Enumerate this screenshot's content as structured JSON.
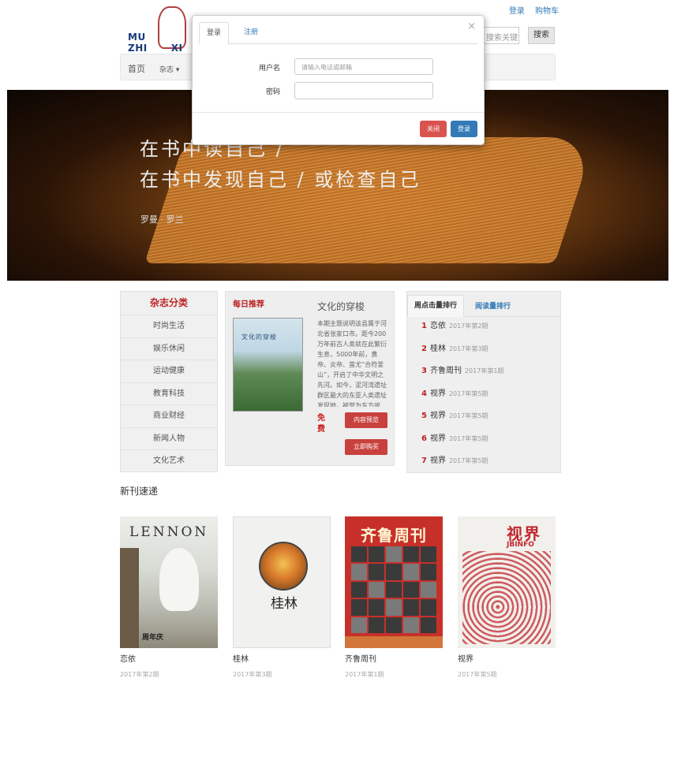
{
  "header": {
    "links": [
      "登录",
      "购物车"
    ],
    "logo_text": "MU ZHI",
    "logo_tail": "XI",
    "search_placeholder": "搜索关键词",
    "search_button": "搜索"
  },
  "nav": {
    "home": "首页",
    "magazine": "杂志 ▾"
  },
  "hero": {
    "line1": "在书中读自己 /",
    "line2": "在书中发现自己 / 或检查自己",
    "author": "罗曼 · 罗兰"
  },
  "categories": {
    "title": "杂志分类",
    "items": [
      "时尚生活",
      "娱乐休闲",
      "运动健康",
      "教育科技",
      "商业财经",
      "新闻人物",
      "文化艺术"
    ]
  },
  "daily": {
    "label": "每日推荐",
    "cover_title": "文化的穿梭",
    "name": "文化的穿梭",
    "description": "本期主题说明该县属于河北省张家口市。距今200万年前古人类就在此繁衍生息，5000年前，黄帝、炎帝、蚩尤“合符釜山”，开启了中华文明之先河。如今，泥河湾遗址群区最大的东亚人类遗址发现地，被誉为东方故乡。",
    "free": "免费",
    "preview_button": "内容预览",
    "buy_button": "立即购买"
  },
  "ranking": {
    "tab_active": "周点击量排行",
    "tab_other": "阅读量排行",
    "rows": [
      {
        "num": "1",
        "name": "恋依",
        "issue": "2017年第2期"
      },
      {
        "num": "2",
        "name": "桂林",
        "issue": "2017年第3期"
      },
      {
        "num": "3",
        "name": "齐鲁周刊",
        "issue": "2017年第1期"
      },
      {
        "num": "4",
        "name": "视界",
        "issue": "2017年第5期"
      },
      {
        "num": "5",
        "name": "视界",
        "issue": "2017年第5期"
      },
      {
        "num": "6",
        "name": "视界",
        "issue": "2017年第5期"
      },
      {
        "num": "7",
        "name": "视界",
        "issue": "2017年第5期"
      }
    ]
  },
  "new_releases": {
    "title": "新刊速递",
    "items": [
      {
        "name": "恋依",
        "issue": "2017年第2期",
        "cover_title": "LENNON",
        "cover_foot": "周年庆"
      },
      {
        "name": "桂林",
        "issue": "2017年第3期",
        "cover_title": "桂林"
      },
      {
        "name": "齐鲁周刊",
        "issue": "2017年第1期",
        "cover_title": "齐鲁周刊"
      },
      {
        "name": "视界",
        "issue": "2017年第5期",
        "cover_title": "视界",
        "cover_sub": "JBINFO"
      }
    ]
  },
  "modal": {
    "tab_login": "登录",
    "tab_register": "注册",
    "close_icon": "×",
    "username_label": "用户名",
    "username_placeholder": "请输入电话或邮箱",
    "password_label": "密码",
    "close_button": "关闭",
    "login_button": "登录"
  },
  "colors": {
    "accent_red": "#c9413e",
    "link_blue": "#337ab7",
    "title_red": "#b22222"
  }
}
